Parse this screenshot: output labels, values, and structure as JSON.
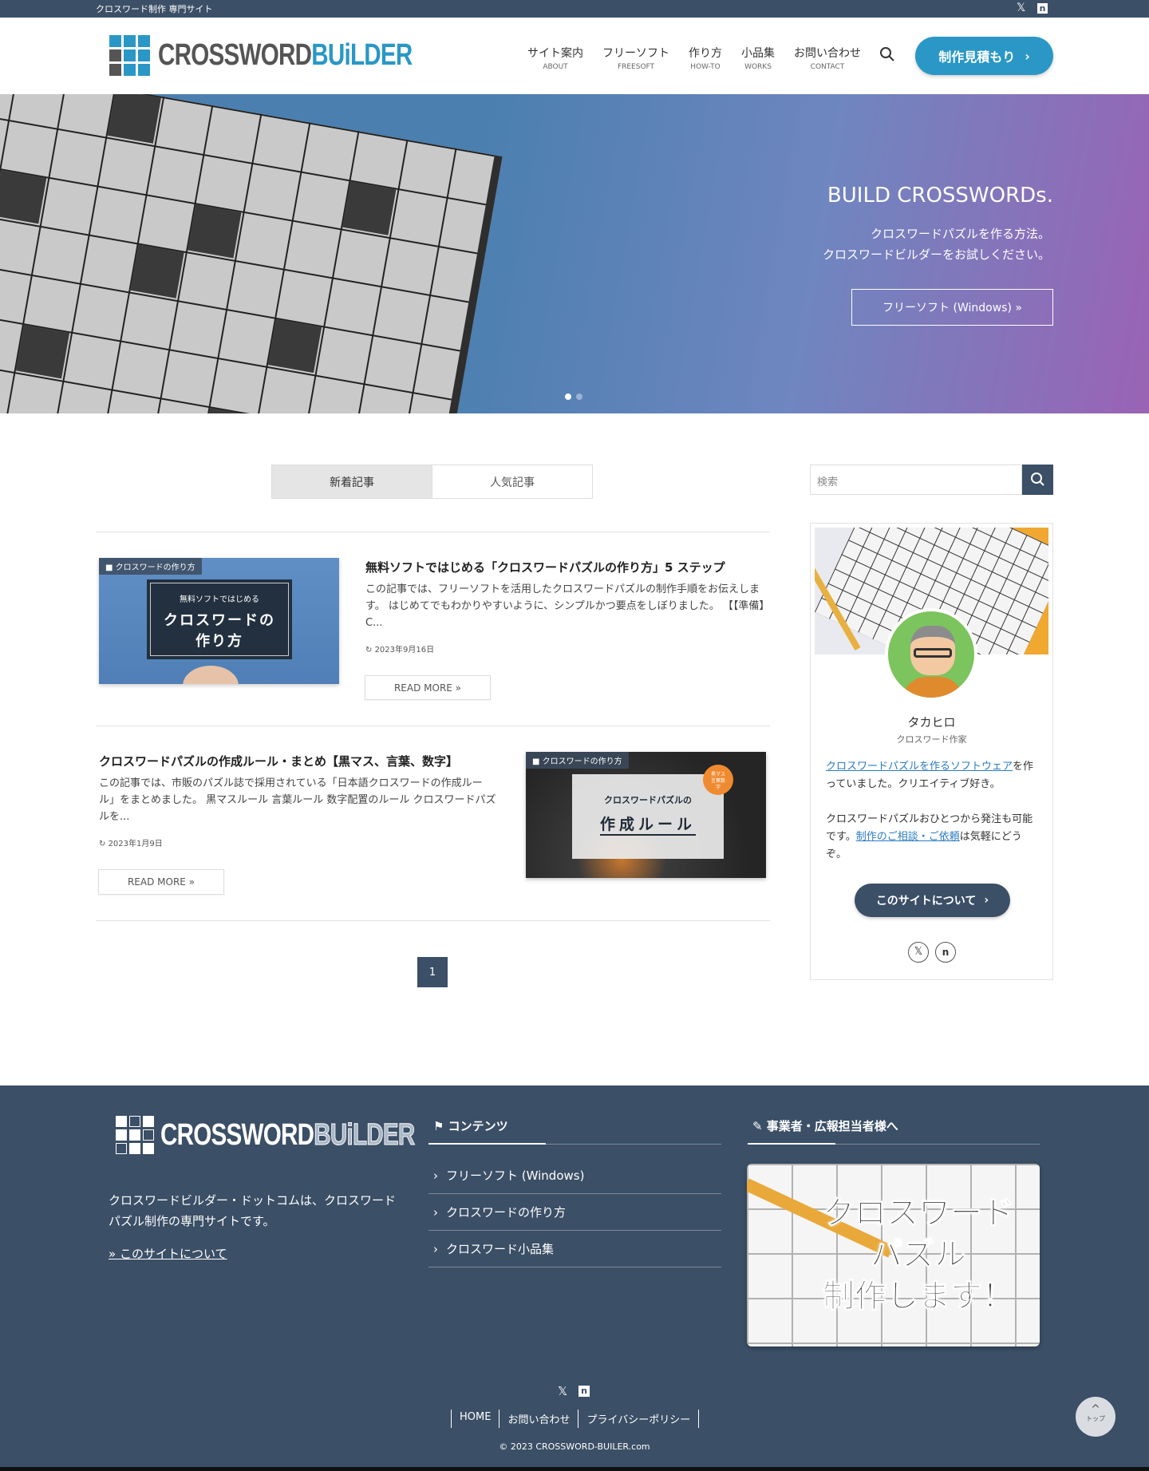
{
  "topbar": {
    "tagline": "クロスワード制作 専門サイト",
    "icons": [
      "x-icon",
      "note-icon"
    ]
  },
  "header": {
    "logo": {
      "text_a": "CROSSWORD",
      "text_b": "BUiLDER"
    },
    "nav": [
      {
        "label": "サイト案内",
        "sub": "ABOUT"
      },
      {
        "label": "フリーソフト",
        "sub": "FREESOFT"
      },
      {
        "label": "作り方",
        "sub": "HOW-TO"
      },
      {
        "label": "小品集",
        "sub": "WORKS"
      },
      {
        "label": "お問い合わせ",
        "sub": "CONTACT"
      }
    ],
    "cta": "制作見積もり"
  },
  "hero": {
    "title": "BUILD CROSSWORDs.",
    "line1": "クロスワードパズルを作る方法。",
    "line2": "クロスワードビルダーをお試しください。",
    "button": "フリーソフト (Windows) »",
    "slide_count": 2,
    "active_slide": 1
  },
  "tabs": [
    {
      "label": "新着記事",
      "active": true
    },
    {
      "label": "人気記事",
      "active": false
    }
  ],
  "articles": [
    {
      "category": "クロスワードの作り方",
      "thumb_line1": "無料ソフトではじめる",
      "thumb_line2": "クロスワードの",
      "thumb_line3": "作り方",
      "title": "無料ソフトではじめる「クロスワードパズルの作り方」5 ステップ",
      "excerpt": "この記事では、フリーソフトを活用したクロスワードパズルの制作手順をお伝えします。 はじめてでもわかりやすいように、シンプルかつ要点をしぼりました。 【【準備】C...",
      "date": "2023年9月16日",
      "read_more": "READ MORE »"
    },
    {
      "category": "クロスワードの作り方",
      "thumb_line1": "クロスワードパズルの",
      "thumb_line2": "作成ルール",
      "badge": "黒マス言葉数字",
      "title": "クロスワードパズルの作成ルール・まとめ【黒マス、言葉、数字】",
      "excerpt": "この記事では、市販のパズル誌で採用されている「日本語クロスワードの作成ルール」をまとめました。 黒マスルール 言葉ルール 数字配置のルール クロスワードパズルを...",
      "date": "2023年1月9日",
      "read_more": "READ MORE »"
    }
  ],
  "pagination": {
    "current": "1"
  },
  "sidebar": {
    "search_placeholder": "検索",
    "profile": {
      "name": "タカヒロ",
      "role": "クロスワード作家",
      "link1": "クロスワードパズルを作るソフトウェア",
      "text1": "を作っていました。クリエイティブ好き。",
      "text2a": "クロスワードパズルおひとつから発注も可能です。",
      "link2": "制作のご相談・ご依頼",
      "text2b": "は気軽にどうぞ。",
      "button": "このサイトについて"
    }
  },
  "footer": {
    "logo": {
      "text_a": "CROSSWORD",
      "text_b": "BUiLDER"
    },
    "description": "クロスワードビルダー・ドットコムは、クロスワードパズル制作の専門サイトです。",
    "about_link": "» このサイトについて",
    "contents_heading": "コンテンツ",
    "contents": [
      "フリーソフト (Windows)",
      "クロスワードの作り方",
      "クロスワード小品集"
    ],
    "business_heading": "事業者・広報担当者様へ",
    "banner_line1": "クロスワード",
    "banner_line2": "パズル",
    "banner_line3": "制作します！",
    "links": [
      "HOME",
      "お問い合わせ",
      "プライバシーポリシー"
    ],
    "copyright": "© 2023 CROSSWORD-BUILER.com",
    "top_button": "トップ"
  },
  "colors": {
    "brand_blue": "#2a97c6",
    "navy": "#3b4f66",
    "logo_gray": "#555555"
  }
}
